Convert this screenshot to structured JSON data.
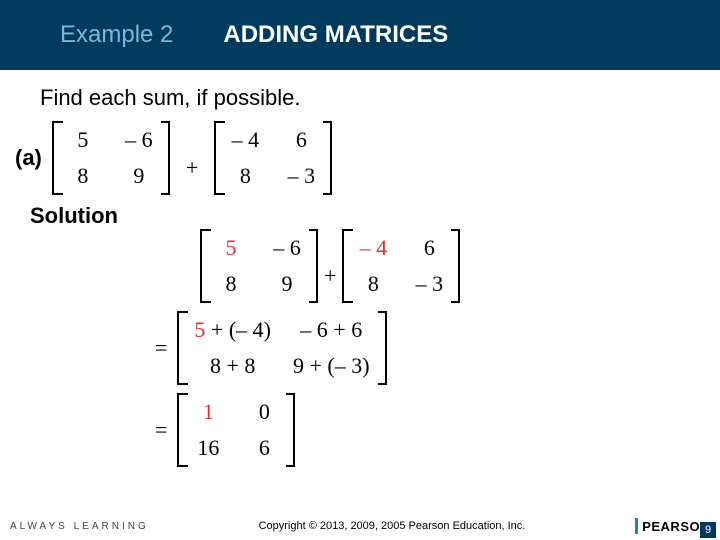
{
  "header": {
    "example": "Example 2",
    "title": "ADDING MATRICES"
  },
  "instruction": "Find each sum, if possible.",
  "part": {
    "label": "(a)",
    "matrix_a": {
      "r1c1": "5",
      "r1c2": "– 6",
      "r2c1": "8",
      "r2c2": "9"
    },
    "op": "+",
    "matrix_b": {
      "r1c1": "– 4",
      "r1c2": "6",
      "r2c1": "8",
      "r2c2": "– 3"
    }
  },
  "solution": {
    "label": "Solution",
    "step1": {
      "matrix_a": {
        "r1c1": "5",
        "r1c2": "– 6",
        "r2c1": "8",
        "r2c2": "9"
      },
      "op": "+",
      "matrix_b": {
        "r1c1": "– 4",
        "r1c2": "6",
        "r2c1": "8",
        "r2c2": "– 3"
      }
    },
    "step2": {
      "eq": "=",
      "matrix": {
        "r1c1a": "5",
        "r1c1b": "+ (– 4)",
        "r1c2": "– 6 + 6",
        "r2c1": "8 + 8",
        "r2c2": "9 + (– 3)"
      }
    },
    "step3": {
      "eq": "=",
      "matrix": {
        "r1c1": "1",
        "r1c2": "0",
        "r2c1": "16",
        "r2c2": "6"
      }
    }
  },
  "footer": {
    "always": "ALWAYS LEARNING",
    "copyright": "Copyright © 2013, 2009, 2005 Pearson Education, Inc.",
    "brand": "PEARSON",
    "slide": "9"
  }
}
